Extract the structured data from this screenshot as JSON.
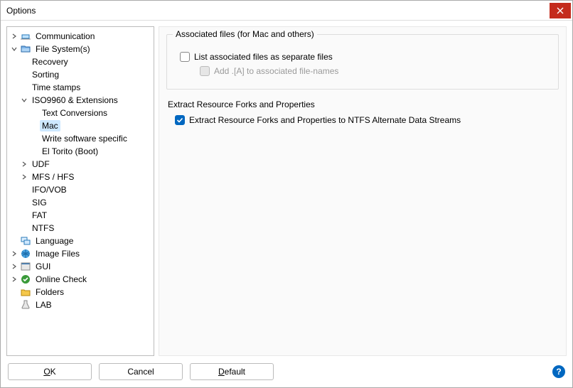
{
  "window": {
    "title": "Options"
  },
  "tree": {
    "items": [
      {
        "label": "Communication",
        "icon": "comm",
        "expandable": true,
        "expanded": false
      },
      {
        "label": "File System(s)",
        "icon": "fs",
        "expandable": true,
        "expanded": true,
        "children": [
          {
            "label": "Recovery"
          },
          {
            "label": "Sorting"
          },
          {
            "label": "Time stamps"
          },
          {
            "label": "ISO9960 & Extensions",
            "expandable": true,
            "expanded": true,
            "children": [
              {
                "label": "Text Conversions"
              },
              {
                "label": "Mac",
                "selected": true
              },
              {
                "label": "Write software specific"
              },
              {
                "label": "El Torito (Boot)"
              }
            ]
          },
          {
            "label": "UDF",
            "expandable": true,
            "expanded": false
          },
          {
            "label": "MFS / HFS",
            "expandable": true,
            "expanded": false
          },
          {
            "label": "IFO/VOB"
          },
          {
            "label": "SIG"
          },
          {
            "label": "FAT"
          },
          {
            "label": "NTFS"
          }
        ]
      },
      {
        "label": "Language",
        "icon": "lang"
      },
      {
        "label": "Image Files",
        "icon": "img",
        "expandable": true,
        "expanded": false
      },
      {
        "label": "GUI",
        "icon": "gui",
        "expandable": true,
        "expanded": false
      },
      {
        "label": "Online Check",
        "icon": "online",
        "expandable": true,
        "expanded": false
      },
      {
        "label": "Folders",
        "icon": "folder"
      },
      {
        "label": "LAB",
        "icon": "lab"
      }
    ]
  },
  "group1": {
    "legend": "Associated files (for Mac and others)",
    "chk1": {
      "label": "List associated files as separate files",
      "checked": false
    },
    "chk2": {
      "label": "Add .[A] to associated file-names",
      "checked": false,
      "disabled": true
    }
  },
  "section2": {
    "label": "Extract Resource Forks and Properties",
    "chk": {
      "label": "Extract Resource Forks and Properties to NTFS Alternate Data Streams",
      "checked": true
    }
  },
  "buttons": {
    "ok": "OK",
    "cancel": "Cancel",
    "default": "Default"
  }
}
